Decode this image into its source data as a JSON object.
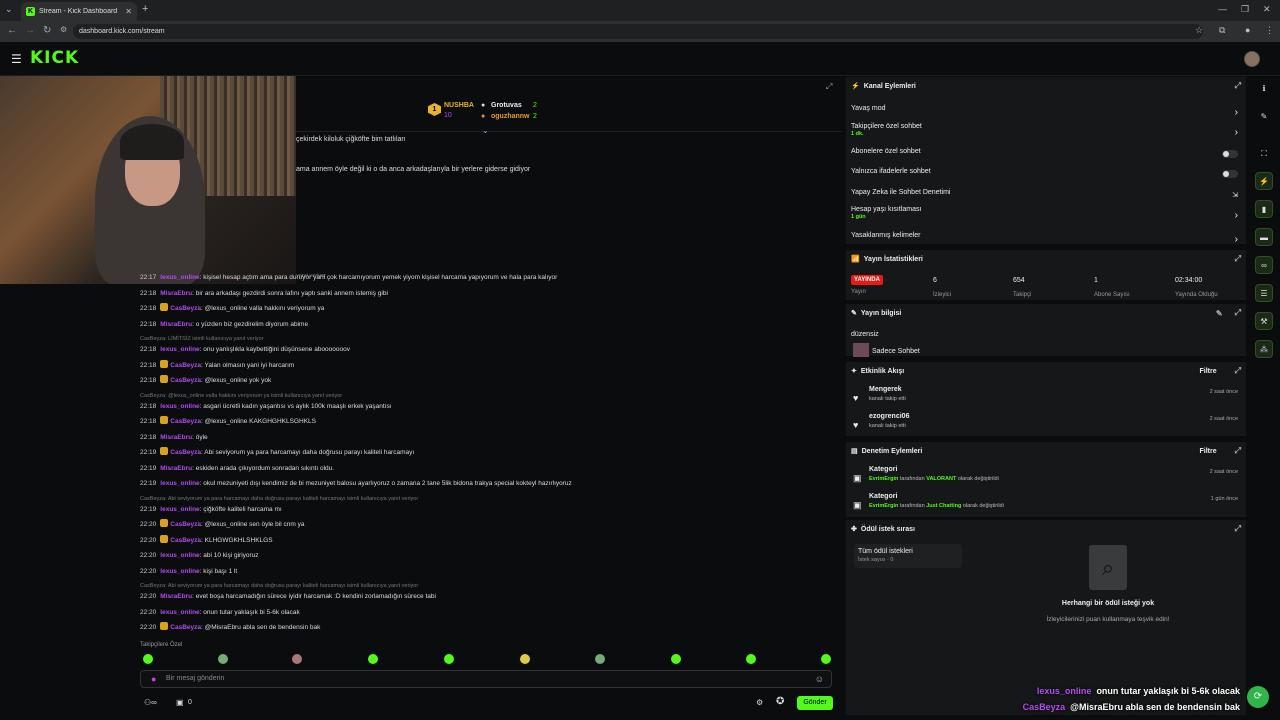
{
  "browser": {
    "tab_title": "Stream - Kick Dashboard",
    "url": "dashboard.kick.com/stream"
  },
  "site": {
    "logo": "KICK"
  },
  "leaderboard": [
    {
      "name": "NUSHBA",
      "count": "10"
    },
    {
      "name": "Grotuvas",
      "count": "2"
    },
    {
      "name": "oguzhannw",
      "count": "2"
    }
  ],
  "pinned": [
    "çekirdek kiloluk çiğköfte bim tatlıları",
    "ama annem öyle değil ki o da anca arkadaşlarıyla bir yerlere giderse gidiyor"
  ],
  "chat_top_reply": "yanıt veriyor",
  "chat": [
    {
      "type": "msg",
      "time": "22:17",
      "user": "lexus_online",
      "color": "#b44cf0",
      "badge": false,
      "text": "kişisel hesap açtım ama para duruyor yani çok harcamıyorum yemek yiyom kişisel harcama yapıyorum ve hala para kalıyor"
    },
    {
      "type": "msg",
      "time": "22:18",
      "user": "MisraEbru",
      "color": "#b44cf0",
      "badge": false,
      "text": "bir ara arkadaşı gezdirdi sonra lafını yaptı sanki annem istemiş gibi"
    },
    {
      "type": "msg",
      "time": "22:18",
      "user": "CasBeyza",
      "color": "#b44cf0",
      "badge": true,
      "text": "@lexus_online valla hakkını veriyorum ya"
    },
    {
      "type": "msg",
      "time": "22:18",
      "user": "MisraEbru",
      "color": "#b44cf0",
      "badge": false,
      "text": "o yüzden biz gezdirelim diyorum abime"
    },
    {
      "type": "reply",
      "text": "CasBeyza: LİMİTSİZ isimli kullanıcıya yanıt veriyor"
    },
    {
      "type": "msg",
      "time": "22:18",
      "user": "lexus_online",
      "color": "#b44cf0",
      "badge": false,
      "text": "onu yanlışlıkla kaybettiğini düşünsene abooooooov"
    },
    {
      "type": "msg",
      "time": "22:18",
      "user": "CasBeyza",
      "color": "#b44cf0",
      "badge": true,
      "text": "Yalan olmasın yani iyi harcarım"
    },
    {
      "type": "msg",
      "time": "22:18",
      "user": "CasBeyza",
      "color": "#b44cf0",
      "badge": true,
      "text": "@lexus_online yok yok"
    },
    {
      "type": "reply",
      "text": "CasBeyza: @lexus_online valla hakkını veriyorum ya isimli kullanıcıya yanıt veriyor"
    },
    {
      "type": "msg",
      "time": "22:18",
      "user": "lexus_online",
      "color": "#b44cf0",
      "badge": false,
      "text": "asgari ücretli kadın yaşantısı vs aylık 100k maaşlı erkek yaşantısı"
    },
    {
      "type": "msg",
      "time": "22:18",
      "user": "CasBeyza",
      "color": "#b44cf0",
      "badge": true,
      "text": "@lexus_online KAKGHGHKLSGHKLS"
    },
    {
      "type": "msg",
      "time": "22:18",
      "user": "MisraEbru",
      "color": "#b44cf0",
      "badge": false,
      "text": "öyle"
    },
    {
      "type": "msg",
      "time": "22:19",
      "user": "CasBeyza",
      "color": "#b44cf0",
      "badge": true,
      "text": "Abi seviyorum ya para harcamayı daha doğrusu parayı kaliteli harcamayı"
    },
    {
      "type": "msg",
      "time": "22:19",
      "user": "MisraEbru",
      "color": "#b44cf0",
      "badge": false,
      "text": "eskiden arada çıkıyordum sonradan sıkıntı oldu."
    },
    {
      "type": "msg",
      "time": "22:19",
      "user": "lexus_online",
      "color": "#b44cf0",
      "badge": false,
      "text": "okul mezuniyeti dışı kendimiz de bi mezuniyet balosu ayarlıyoruz o zamana 2 tane 5lik bidona trakya special kokteyl hazırlıyoruz"
    },
    {
      "type": "reply",
      "text": "CasBeyza: Abi seviyorum ya para harcamayı daha doğrusu parayı kaliteli harcamayı isimli kullanıcıya yanıt veriyor"
    },
    {
      "type": "msg",
      "time": "22:19",
      "user": "lexus_online",
      "color": "#b44cf0",
      "badge": false,
      "text": "çiğköfte kaliteli harcama mı"
    },
    {
      "type": "msg",
      "time": "22:20",
      "user": "CasBeyza",
      "color": "#b44cf0",
      "badge": true,
      "text": "@lexus_online sen öyle bil cnm ya"
    },
    {
      "type": "msg",
      "time": "22:20",
      "user": "CasBeyza",
      "color": "#b44cf0",
      "badge": true,
      "text": "KLHGWGKHLSHKLGS"
    },
    {
      "type": "msg",
      "time": "22:20",
      "user": "lexus_online",
      "color": "#b44cf0",
      "badge": false,
      "text": "abi 10 kişi giriyoruz"
    },
    {
      "type": "msg",
      "time": "22:20",
      "user": "lexus_online",
      "color": "#b44cf0",
      "badge": false,
      "text": "kişi başı 1 lt"
    },
    {
      "type": "reply",
      "text": "CasBeyza: Abi seviyorum ya para harcamayı daha doğrusu parayı kaliteli harcamayı isimli kullanıcıya yanıt veriyor"
    },
    {
      "type": "msg",
      "time": "22:20",
      "user": "MisraEbru",
      "color": "#b44cf0",
      "badge": false,
      "text": "evet boşa harcamadığın sürece iyidir harcamak :D kendini zorlamadığın sürece tabi"
    },
    {
      "type": "msg",
      "time": "22:20",
      "user": "lexus_online",
      "color": "#b44cf0",
      "badge": false,
      "text": "onun tutar yaklaşık bi 5-6k olacak"
    },
    {
      "type": "msg",
      "time": "22:20",
      "user": "CasBeyza",
      "color": "#b44cf0",
      "badge": true,
      "text": "@MisraEbru abla sen de bendensin bak"
    }
  ],
  "chat_footer": {
    "follow_label": "Takipçilere Özel",
    "placeholder": "Bir mesaj gönderin",
    "send": "Gönder",
    "count": "0"
  },
  "channel_actions": {
    "title": "Kanal Eylemleri",
    "items": [
      {
        "label": "Yavaş mod",
        "kind": "chevron"
      },
      {
        "label": "Takipçilere özel sohbet",
        "sub": "1 dk.",
        "kind": "chevron"
      },
      {
        "label": "Abonelere özel sohbet",
        "kind": "toggle"
      },
      {
        "label": "Yalnızca ifadelerle sohbet",
        "kind": "toggle"
      },
      {
        "label": "Yapay Zeka ile Sohbet Denetimi",
        "kind": "ext"
      },
      {
        "label": "Hesap yaşı kısıtlaması",
        "sub": "1 gün",
        "kind": "chevron"
      },
      {
        "label": "Yasaklanmış kelimeler",
        "kind": "chevron"
      }
    ]
  },
  "stats": {
    "title": "Yayın İstatistikleri",
    "live": "YAYINDA",
    "live_sub": "Yayın",
    "items": [
      {
        "value": "6",
        "label": "İzleyici"
      },
      {
        "value": "654",
        "label": "Takipçi"
      },
      {
        "value": "1",
        "label": "Abone Sayısı"
      },
      {
        "value": "02:34:00",
        "label": "Yayında Olduğu"
      }
    ]
  },
  "stream_info": {
    "title": "Yayın bilgisi",
    "stream_title": "düzensiz",
    "category": "Sadece Sohbet"
  },
  "activity": {
    "title": "Etkinlik Akışı",
    "filter": "Filtre",
    "items": [
      {
        "name": "Mengerek",
        "sub": "kanalı takip etti",
        "ago": "2 saat önce"
      },
      {
        "name": "ezogrenci06",
        "sub": "kanalı takip etti",
        "ago": "2 saat önce"
      }
    ]
  },
  "moderation": {
    "title": "Denetim Eylemleri",
    "filter": "Filtre",
    "items": [
      {
        "name": "Kategori",
        "by": "EvrimErgin",
        "mid": "tarafından",
        "value": "VALORANT",
        "tail": "olarak değiştirildi",
        "ago": "2 saat önce"
      },
      {
        "name": "Kategori",
        "by": "EvrimErgin",
        "mid": "tarafından",
        "value": "Just Chatting",
        "tail": "olarak değiştirildi",
        "ago": "1 gün önce"
      }
    ]
  },
  "rewards": {
    "title": "Ödül istek sırası",
    "tab_label": "Tüm ödül istekleri",
    "tab_sub": "İstek sayısı · 0",
    "empty_title": "Herhangi bir ödül isteği yok",
    "empty_sub": "İzleyicilerinizi puan kullanmaya teşvik edin!"
  },
  "overlay": [
    {
      "user": "lexus_online",
      "text": "onun tutar yaklaşık bi 5-6k olacak"
    },
    {
      "user": "CasBeyza",
      "text": "@MisraEbru abla sen de bendensin bak"
    }
  ],
  "colors": {
    "accent": "#53fc18",
    "live": "#e91916",
    "username": "#b44cf0"
  }
}
